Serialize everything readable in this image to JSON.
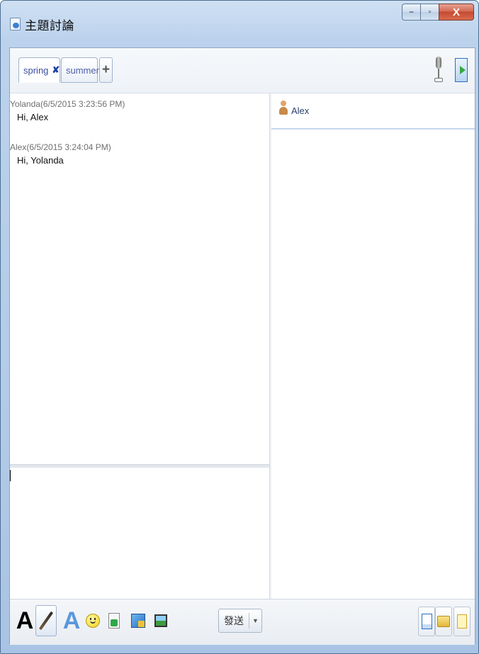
{
  "window": {
    "title": "主題討論",
    "controls": {
      "minimize": "–",
      "maximize": "▫",
      "close": "X"
    }
  },
  "tabs": [
    {
      "label": "spring",
      "close": "✘",
      "active": true
    },
    {
      "label": "summer",
      "active": false
    }
  ],
  "add_tab_label": "+",
  "messages": [
    {
      "header": "Yolanda(6/5/2015 3:23:56 PM)",
      "body": "Hi, Alex"
    },
    {
      "header": "Alex(6/5/2015 3:24:04 PM)",
      "body": "Hi, Yolanda"
    }
  ],
  "participants": [
    {
      "name": "Alex"
    }
  ],
  "toolbar": {
    "font_label": "A",
    "color_label": "A",
    "send_label": "發送",
    "send_dropdown": "▼",
    "icons": [
      "font-icon",
      "brush-icon",
      "font-color-icon",
      "emoticon-icon",
      "send-file-icon",
      "screenshot-icon",
      "image-icon"
    ],
    "right_icons": [
      "chat-history-icon",
      "shared-files-icon",
      "notes-icon"
    ]
  },
  "colors": {
    "accent": "#3a4f9c",
    "title_bar": "#b3cbe8",
    "close_button": "#c44a30"
  }
}
